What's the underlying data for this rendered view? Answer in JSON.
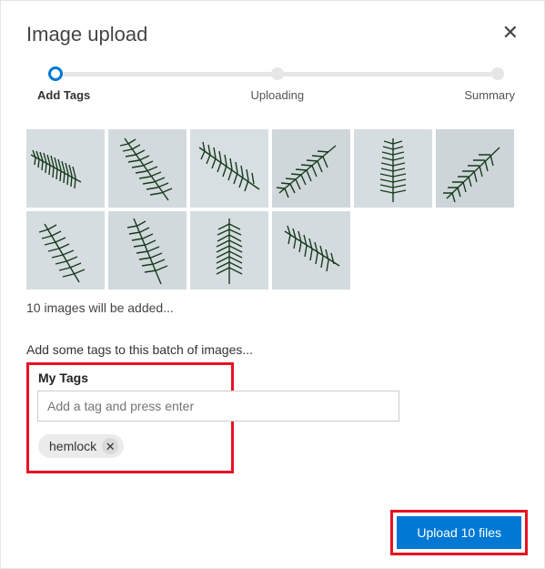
{
  "dialog": {
    "title": "Image upload"
  },
  "stepper": {
    "steps": [
      {
        "label": "Add Tags",
        "active": true
      },
      {
        "label": "Uploading",
        "active": false
      },
      {
        "label": "Summary",
        "active": false
      }
    ]
  },
  "images": {
    "count": 10,
    "count_text": "10 images will be added..."
  },
  "tags": {
    "prompt": "Add some tags to this batch of images...",
    "section_title": "My Tags",
    "input_placeholder": "Add a tag and press enter",
    "chips": [
      {
        "label": "hemlock"
      }
    ]
  },
  "actions": {
    "upload_label": "Upload 10 files"
  },
  "colors": {
    "accent": "#0078d4",
    "highlight_border": "#e81123"
  }
}
